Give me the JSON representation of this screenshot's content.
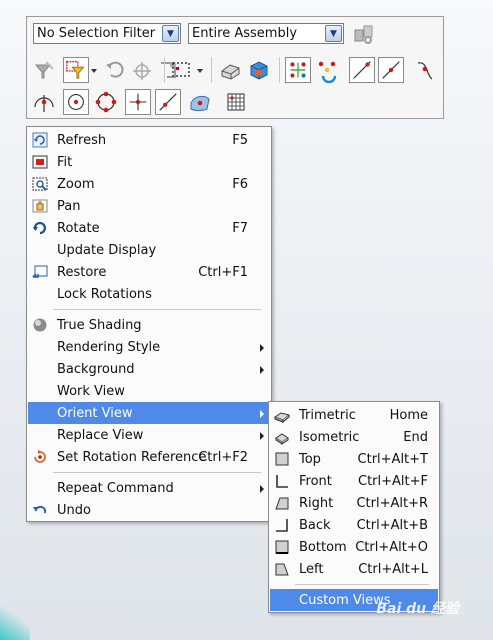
{
  "toolbar": {
    "selection_filter": {
      "value": "No Selection Filter"
    },
    "scope_filter": {
      "value": "Entire Assembly"
    }
  },
  "context_menu": {
    "items": [
      {
        "label": "Refresh",
        "shortcut": "F5",
        "icon": "refresh-icon"
      },
      {
        "label": "Fit",
        "shortcut": "",
        "icon": "fit-icon"
      },
      {
        "label": "Zoom",
        "shortcut": "F6",
        "icon": "zoom-icon"
      },
      {
        "label": "Pan",
        "shortcut": "",
        "icon": "pan-icon"
      },
      {
        "label": "Rotate",
        "shortcut": "F7",
        "icon": "rotate-icon"
      },
      {
        "label": "Update Display",
        "shortcut": ""
      },
      {
        "label": "Restore",
        "shortcut": "Ctrl+F1",
        "icon": "restore-icon"
      },
      {
        "label": "Lock Rotations",
        "shortcut": ""
      },
      {
        "label": "True Shading",
        "shortcut": "",
        "icon": "shading-icon"
      },
      {
        "label": "Rendering Style",
        "shortcut": "",
        "submenu": true
      },
      {
        "label": "Background",
        "shortcut": "",
        "submenu": true
      },
      {
        "label": "Work View",
        "shortcut": ""
      },
      {
        "label": "Orient View",
        "shortcut": "",
        "submenu": true,
        "selected": true
      },
      {
        "label": "Replace View",
        "shortcut": "",
        "submenu": true
      },
      {
        "label": "Set Rotation Reference",
        "shortcut": "Ctrl+F2",
        "icon": "rotation-reference-icon"
      },
      {
        "label": "Repeat Command",
        "shortcut": "",
        "submenu": true
      },
      {
        "label": "Undo",
        "shortcut": "",
        "icon": "undo-icon"
      }
    ]
  },
  "orient_submenu": {
    "items": [
      {
        "label": "Trimetric",
        "shortcut": "Home",
        "icon": "trimetric-icon"
      },
      {
        "label": "Isometric",
        "shortcut": "End",
        "icon": "isometric-icon"
      },
      {
        "label": "Top",
        "shortcut": "Ctrl+Alt+T",
        "icon": "top-view-icon"
      },
      {
        "label": "Front",
        "shortcut": "Ctrl+Alt+F",
        "icon": "front-view-icon"
      },
      {
        "label": "Right",
        "shortcut": "Ctrl+Alt+R",
        "icon": "right-view-icon"
      },
      {
        "label": "Back",
        "shortcut": "Ctrl+Alt+B",
        "icon": "back-view-icon"
      },
      {
        "label": "Bottom",
        "shortcut": "Ctrl+Alt+O",
        "icon": "bottom-view-icon"
      },
      {
        "label": "Left",
        "shortcut": "Ctrl+Alt+L",
        "icon": "left-view-icon"
      },
      {
        "label": "Custom Views",
        "shortcut": "",
        "selected": true
      }
    ]
  },
  "watermark": "Bai du 经验",
  "colors": {
    "selection": "#4f8ae8",
    "snap_point": "#d01818",
    "menu_bg": "#fbfbfb"
  }
}
